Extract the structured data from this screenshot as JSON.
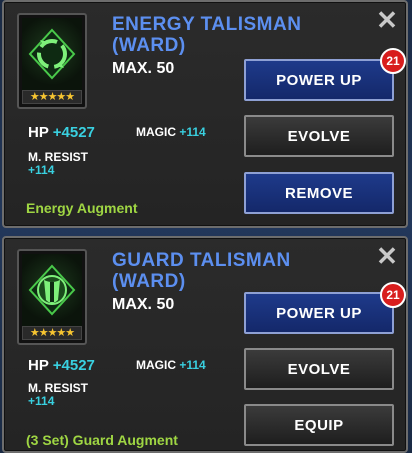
{
  "colors": {
    "title_blue": "#5c8ff0",
    "stat_cyan": "#39d0e0",
    "augment_green": "#9fd643",
    "badge_red": "#d81d1d",
    "star_gold": "#f7c531"
  },
  "panels": [
    {
      "title_line1": "ENERGY TALISMAN",
      "title_line2": "(WARD)",
      "max_level": "MAX. 50",
      "stars": "★★★★★",
      "icon": "energy-swirl-icon",
      "hp_label": "HP",
      "hp_value": "+4527",
      "magic_label": "MAGIC",
      "magic_value": "+114",
      "mresist_label": "M. RESIST",
      "mresist_value": "+114",
      "augment": "Energy Augment",
      "buttons": {
        "power_up": "POWER UP",
        "power_up_badge": "21",
        "evolve": "EVOLVE",
        "action": "REMOVE"
      },
      "close": "✕"
    },
    {
      "title_line1": "GUARD TALISMAN",
      "title_line2": "(WARD)",
      "max_level": "MAX. 50",
      "stars": "★★★★★",
      "icon": "guard-shield-icon",
      "hp_label": "HP",
      "hp_value": "+4527",
      "magic_label": "MAGIC",
      "magic_value": "+114",
      "mresist_label": "M. RESIST",
      "mresist_value": "+114",
      "augment": "(3 Set) Guard Augment",
      "buttons": {
        "power_up": "POWER UP",
        "power_up_badge": "21",
        "evolve": "EVOLVE",
        "action": "EQUIP"
      },
      "close": "✕"
    }
  ]
}
